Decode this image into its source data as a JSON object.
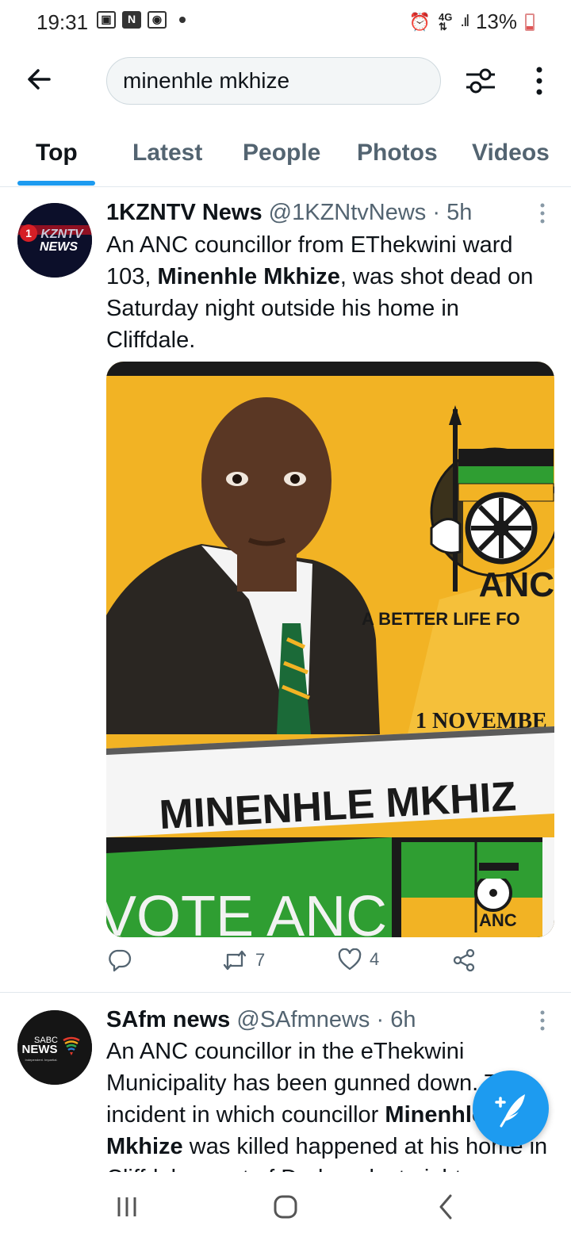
{
  "status_bar": {
    "time": "19:31",
    "battery": "13%"
  },
  "search": {
    "query": "minenhle mkhize"
  },
  "tabs": [
    {
      "label": "Top",
      "active": true
    },
    {
      "label": "Latest"
    },
    {
      "label": "People"
    },
    {
      "label": "Photos"
    },
    {
      "label": "Videos"
    }
  ],
  "tweets": [
    {
      "name": "1KZNTV News",
      "handle": "@1KZNtvNews",
      "time": "· 5h",
      "avatar_text": "KZNTV NEWS",
      "text_parts": [
        "An ANC councillor from EThekwini ward 103, ",
        "Minenhle Mkhize",
        ", was shot dead on Saturday night outside his home in Cliffdale."
      ],
      "image_text": {
        "banner_name": "MINENHLE MKHIZ",
        "date": "1 NOVEMBE",
        "logo": "ANC",
        "slogan": "A BETTER LIFE FO",
        "vote": "VOTE ANC",
        "small_logo": "ANC"
      },
      "retweets": "7",
      "likes": "4"
    },
    {
      "name": "SAfm news",
      "handle": "@SAfmnews",
      "time": "· 6h",
      "avatar_text": "SABC NEWS",
      "avatar_tagline": "Independent. Impartial.",
      "text_parts": [
        "An ANC councillor in the eThekwini Municipality has been gunned down. The incident in which councillor ",
        "Minenhle",
        " ",
        "Mkhize",
        " was killed happened at his home in Cliffdale, west of Durban, last night."
      ]
    }
  ],
  "colors": {
    "accent": "#1d9bf0",
    "anc_yellow": "#f4b926",
    "anc_green": "#2f9e32"
  }
}
